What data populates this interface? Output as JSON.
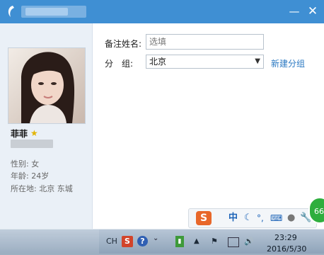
{
  "window": {
    "minimize_glyph": "—",
    "close_glyph": "✕"
  },
  "profile": {
    "nickname": "菲菲",
    "gender": "性别: 女",
    "age": "年龄: 24岁",
    "location": "所在地: 北京 东城"
  },
  "form": {
    "remark_label": "备注姓名:",
    "remark_placeholder": "选填",
    "group_label": "分　组:",
    "group_value": "北京",
    "new_group_link": "新建分组"
  },
  "ime": {
    "logo": "S",
    "mode": "中",
    "icons": [
      "moon-icon",
      "punctuation-icon",
      "keyboard-icon",
      "user-icon",
      "tool-icon"
    ]
  },
  "badge": {
    "text": "66"
  },
  "taskbar": {
    "lang": "CH",
    "time": "23:29",
    "date": "2016/5/30"
  },
  "colors": {
    "titlebar": "#3f8fd3",
    "link": "#2a78c2",
    "left_panel": "#eaf0f7"
  }
}
